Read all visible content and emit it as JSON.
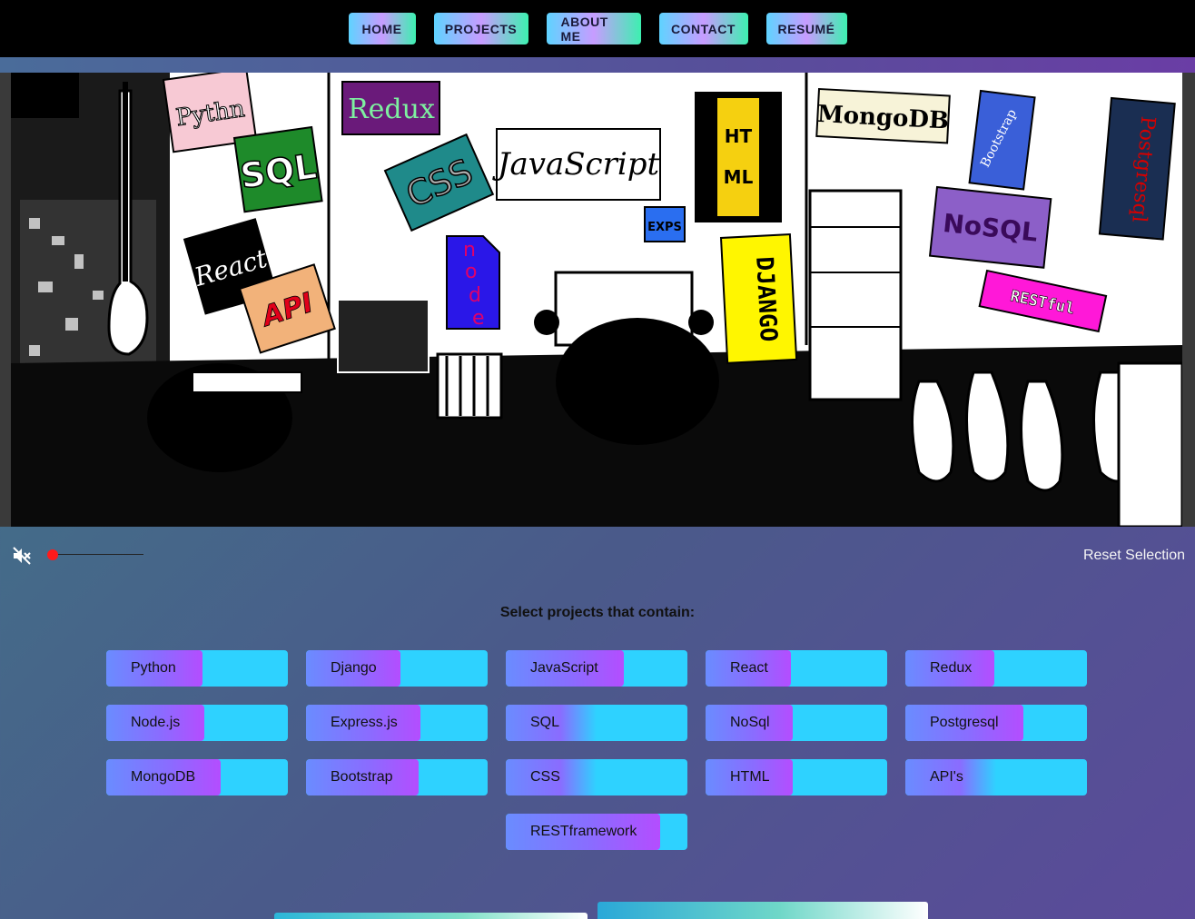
{
  "nav": {
    "items": [
      {
        "label": "HOME"
      },
      {
        "label": "PROJECTS"
      },
      {
        "label": "ABOUT ME"
      },
      {
        "label": "CONTACT"
      },
      {
        "label": "RESUMÉ"
      }
    ]
  },
  "hero": {
    "stickers": [
      "Python",
      "SQL",
      "React",
      "API",
      "Redux",
      "CSS",
      "node",
      "JavaScript",
      "EXPS",
      "HTML",
      "DJANGO",
      "MongoDB",
      "Bootstrap",
      "NoSQL",
      "RESTful",
      "Postgresql"
    ]
  },
  "audio": {
    "icon": "volume-muted-icon",
    "volume_level": 0
  },
  "controls": {
    "reset_label": "Reset Selection"
  },
  "filter": {
    "title": "Select projects that contain:",
    "techs": [
      {
        "label": "Python",
        "level": 0.53
      },
      {
        "label": "Django",
        "level": 0.52
      },
      {
        "label": "JavaScript",
        "level": 0.65
      },
      {
        "label": "React",
        "level": 0.47
      },
      {
        "label": "Redux",
        "level": 0.49
      },
      {
        "label": "Node.js",
        "level": 0.54
      },
      {
        "label": "Express.js",
        "level": 0.63
      },
      {
        "label": "SQL",
        "level": 0.5
      },
      {
        "label": "NoSql",
        "level": 0.48
      },
      {
        "label": "Postgresql",
        "level": 0.65
      },
      {
        "label": "MongoDB",
        "level": 0.63
      },
      {
        "label": "Bootstrap",
        "level": 0.62
      },
      {
        "label": "CSS",
        "level": 0.5
      },
      {
        "label": "HTML",
        "level": 0.48
      },
      {
        "label": "API's",
        "level": 0.5
      },
      {
        "label": "RESTframework",
        "level": 0.85
      }
    ]
  },
  "colors": {
    "nav_bg": "#000000",
    "accent_cyan": "#2ed2ff",
    "accent_purple": "#b44dff",
    "volume_thumb": "#ff1a1a"
  }
}
